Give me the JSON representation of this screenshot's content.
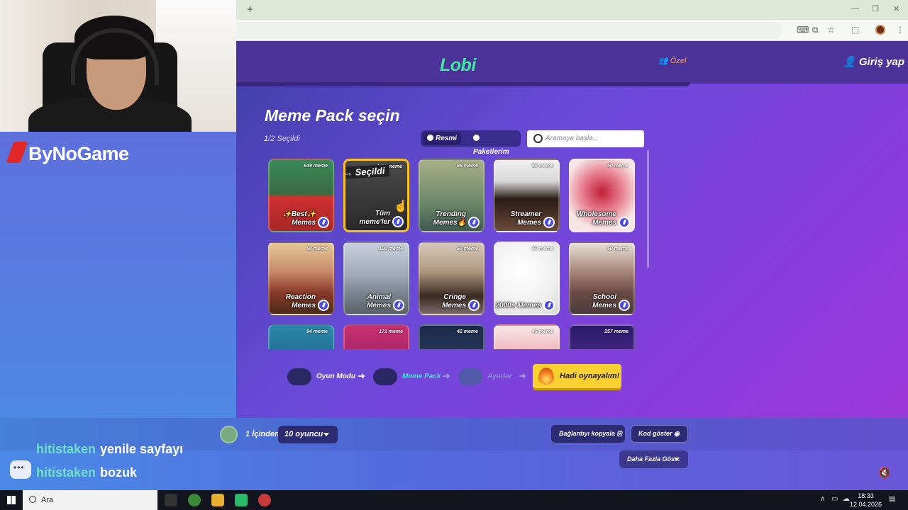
{
  "site": {
    "logo": "Lobi",
    "private_label": "Özel",
    "login_label": "Giriş yap"
  },
  "main": {
    "title": "Meme Pack seçin",
    "selected_prefix": "1",
    "selected_suffix": "/2 Seçildi",
    "toggle": {
      "official": "Resmi",
      "mine": "Paketlerim"
    },
    "search_placeholder": "Aramaya başla...",
    "selected_tag": "→ Seçildi"
  },
  "packs": [
    {
      "count": "649 meme",
      "label": "✨Best✨ Memes",
      "bg": "linear-gradient(180deg,#3a8a5a 0%,#3a6a40 48%,#d03030 52%,#a82828 100%)"
    },
    {
      "count": "1 99 meme",
      "label": "Tüm meme'ler",
      "bg": "linear-gradient(180deg,#4a4a4a 0%,#2a2a2a 100%)",
      "selected": true
    },
    {
      "count": "86 meme",
      "label": "Trending Memes🔥",
      "bg": "linear-gradient(180deg,#a8b088 0%,#6c8868 60%,#3e5a52 100%)"
    },
    {
      "count": "50 meme",
      "label": "Streamer Memes",
      "bg": "linear-gradient(180deg,#f0f0f0 0%,#d8d8d8 30%,#2a1a14 55%,#6a4a3a 100%)"
    },
    {
      "count": "50 meme",
      "label": "Wholesome Memes",
      "bg": "radial-gradient(circle at 50% 45%,#c02038 0%,#e88090 40%,#f6e6e6 75%)"
    },
    {
      "count": "50 meme",
      "label": "Reaction Memes",
      "bg": "linear-gradient(180deg,#e6c898 0%,#c88a6a 40%,#8a3a2a 70%,#4a2a18 100%)"
    },
    {
      "count": "100 meme",
      "label": "Animal Memes",
      "bg": "linear-gradient(180deg,#c8d0dc 0%,#a0aab8 45%,#7a8690 70%,#5a6068 100%)"
    },
    {
      "count": "50 meme",
      "label": "Cringe Memes",
      "bg": "linear-gradient(180deg,#d8c8b8 0%,#b09880 40%,#3a2a24 75%,#7a6a68 100%)"
    },
    {
      "count": "50 meme",
      "label": "2000s Memes",
      "bg": "radial-gradient(circle at 40% 40%,#ffffff 0%,#f0f0f0 60%,#d8d8d8 100%)"
    },
    {
      "count": "50 meme",
      "label": "School Memes",
      "bg": "linear-gradient(180deg,#e8e0d8 0%,#a88878 40%,#6a4a44 70%,#4a3a3a 100%)"
    },
    {
      "count": "94 meme",
      "label": "",
      "bg": "linear-gradient(180deg,#2a88a8 0%,#1a4a7a 100%)"
    },
    {
      "count": "171 meme",
      "label": "",
      "bg": "linear-gradient(180deg,#c83070 0%,#7a1a60 100%)"
    },
    {
      "count": "42 meme",
      "label": "",
      "bg": "linear-gradient(180deg,#1a2a4a 0%,#3a4a6a 100%)"
    },
    {
      "count": "45 meme",
      "label": "",
      "bg": "linear-gradient(180deg,#f8e8e8 0%,#e06070 100%)"
    },
    {
      "count": "257 meme",
      "label": "",
      "bg": "linear-gradient(180deg,#2a1a6a 0%,#6a3aa8 100%)"
    }
  ],
  "steps": {
    "mode": "Oyun Modu",
    "pack": "Meme Pack",
    "settings": "Ayarlar",
    "play": "Hadi oynayalım!"
  },
  "footer": {
    "players_of": "1 İçinden",
    "players_value": "10 oyuncu",
    "copy_link": "Bağlantıyı kopyala",
    "show_code": "Kod göster",
    "show_more": "Daha Fazla Gös..."
  },
  "overlay": {
    "channel": "ByNoGame",
    "chat": [
      {
        "user": "hitistaken",
        "msg": "yenile sayfayı"
      },
      {
        "user": "hitistaken",
        "msg": "bozuk"
      }
    ]
  },
  "taskbar": {
    "search": "Ara",
    "time": "18:33",
    "date": "12.04.2026"
  },
  "colors": {
    "accent_green": "#41ea9a",
    "selected_border": "#f8c020",
    "play_button": "#f8d030"
  }
}
